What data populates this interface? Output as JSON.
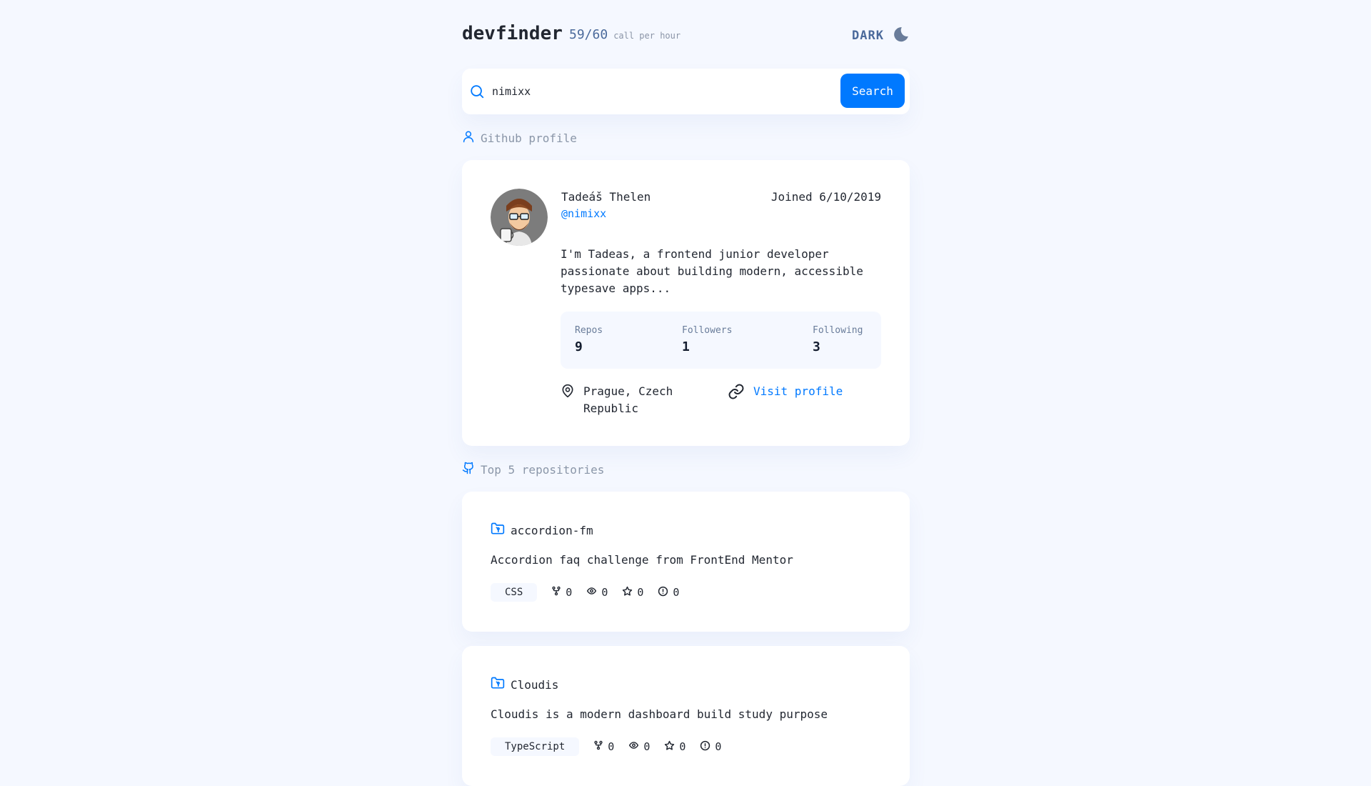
{
  "header": {
    "brand": "devfinder",
    "rate_count": "59/60",
    "rate_label": "call per hour",
    "theme_label": "DARK"
  },
  "search": {
    "value": "nimixx",
    "placeholder": "",
    "button_label": "Search"
  },
  "profile_section": {
    "title": "Github profile"
  },
  "profile": {
    "name": "Tadeáš Thelen",
    "login": "@nimixx",
    "joined": "Joined 6/10/2019",
    "bio": "I'm Tadeas, a frontend junior developer passionate about building modern, accessible typesave apps...",
    "stats": [
      {
        "label": "Repos",
        "value": "9"
      },
      {
        "label": "Followers",
        "value": "1"
      },
      {
        "label": "Following",
        "value": "3"
      }
    ],
    "location": "Prague, Czech Republic",
    "link_label": "Visit profile"
  },
  "repos_section": {
    "title": "Top 5 repositories"
  },
  "repos": [
    {
      "name": "accordion-fm",
      "description": "Accordion faq challenge from FrontEnd Mentor",
      "language": "CSS",
      "forks": "0",
      "watchers": "0",
      "stars": "0",
      "issues": "0"
    },
    {
      "name": "Cloudis",
      "description": "Cloudis is a modern dashboard build study purpose",
      "language": "TypeScript",
      "forks": "0",
      "watchers": "0",
      "stars": "0",
      "issues": "0"
    }
  ],
  "colors": {
    "background": "#f5f8ff",
    "accent": "#0079ff",
    "muted": "#697c9a",
    "text": "#222731"
  },
  "icons": {
    "search": "search-icon",
    "theme": "moon-icon",
    "profile_section": "user-icon",
    "repos_section": "github-icon",
    "location": "map-pin-icon",
    "link": "link-icon",
    "repo": "folder-git-icon",
    "forks": "fork-icon",
    "watchers": "eye-icon",
    "stars": "star-icon",
    "issues": "issue-icon"
  }
}
